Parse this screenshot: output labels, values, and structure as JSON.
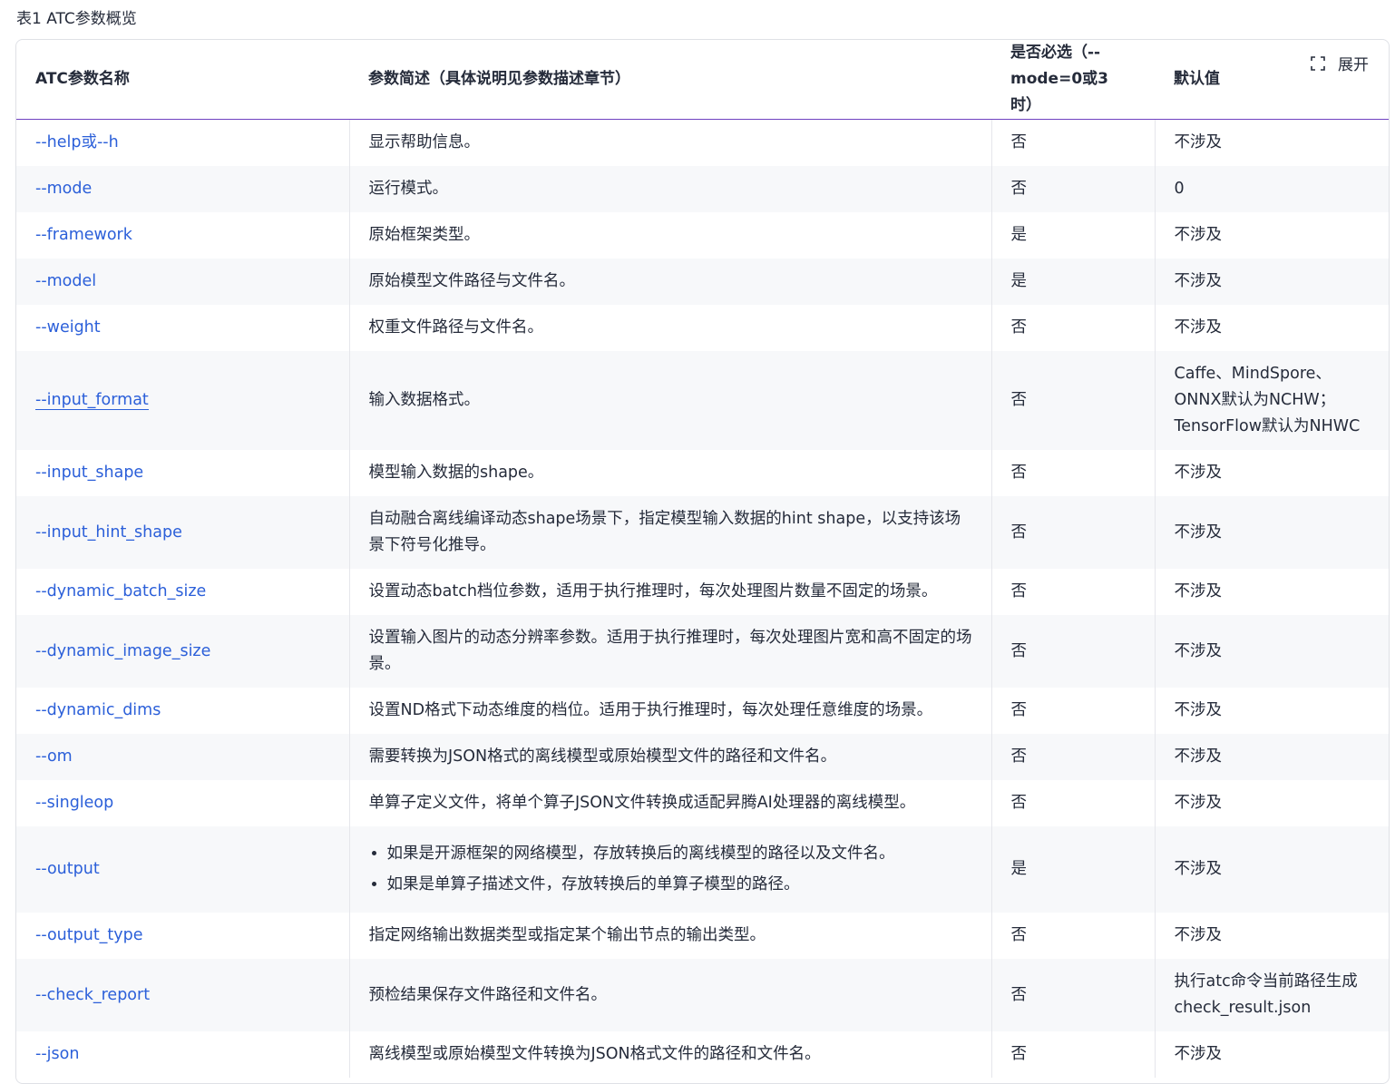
{
  "caption": "表1 ATC参数概览",
  "expand_label": "展开",
  "headers": [
    "ATC参数名称",
    "参数简述（具体说明见参数描述章节）",
    "是否必选（--mode=0或3时）",
    "默认值"
  ],
  "rows": [
    {
      "name": "--help或--h",
      "desc": "显示帮助信息。",
      "required": "否",
      "default": "不涉及"
    },
    {
      "name": "--mode",
      "desc": "运行模式。",
      "required": "否",
      "default": "0"
    },
    {
      "name": "--framework",
      "desc": "原始框架类型。",
      "required": "是",
      "default": "不涉及"
    },
    {
      "name": "--model",
      "desc": "原始模型文件路径与文件名。",
      "required": "是",
      "default": "不涉及"
    },
    {
      "name": "--weight",
      "desc": "权重文件路径与文件名。",
      "required": "否",
      "default": "不涉及"
    },
    {
      "name": "--input_format",
      "desc": "输入数据格式。",
      "required": "否",
      "default": "Caffe、MindSpore、ONNX默认为NCHW；TensorFlow默认为NHWC"
    },
    {
      "name": "--input_shape",
      "desc": "模型输入数据的shape。",
      "required": "否",
      "default": "不涉及"
    },
    {
      "name": "--input_hint_shape",
      "desc": "自动融合离线编译动态shape场景下，指定模型输入数据的hint shape，以支持该场景下符号化推导。",
      "required": "否",
      "default": "不涉及"
    },
    {
      "name": "--dynamic_batch_size",
      "desc": "设置动态batch档位参数，适用于执行推理时，每次处理图片数量不固定的场景。",
      "required": "否",
      "default": "不涉及"
    },
    {
      "name": "--dynamic_image_size",
      "desc": "设置输入图片的动态分辨率参数。适用于执行推理时，每次处理图片宽和高不固定的场景。",
      "required": "否",
      "default": "不涉及"
    },
    {
      "name": "--dynamic_dims",
      "desc": "设置ND格式下动态维度的档位。适用于执行推理时，每次处理任意维度的场景。",
      "required": "否",
      "default": "不涉及"
    },
    {
      "name": "--om",
      "desc": "需要转换为JSON格式的离线模型或原始模型文件的路径和文件名。",
      "required": "否",
      "default": "不涉及"
    },
    {
      "name": "--singleop",
      "desc": "单算子定义文件，将单个算子JSON文件转换成适配昇腾AI处理器的离线模型。",
      "required": "否",
      "default": "不涉及"
    },
    {
      "name": "--output",
      "bullets": [
        "如果是开源框架的网络模型，存放转换后的离线模型的路径以及文件名。",
        "如果是单算子描述文件，存放转换后的单算子模型的路径。"
      ],
      "required": "是",
      "default": "不涉及"
    },
    {
      "name": "--output_type",
      "desc": "指定网络输出数据类型或指定某个输出节点的输出类型。",
      "required": "否",
      "default": "不涉及"
    },
    {
      "name": "--check_report",
      "desc": "预检结果保存文件路径和文件名。",
      "required": "否",
      "default": "执行atc命令当前路径生成check_result.json"
    },
    {
      "name": "--json",
      "desc": "离线模型或原始模型文件转换为JSON格式文件的路径和文件名。",
      "required": "否",
      "default": "不涉及"
    }
  ]
}
